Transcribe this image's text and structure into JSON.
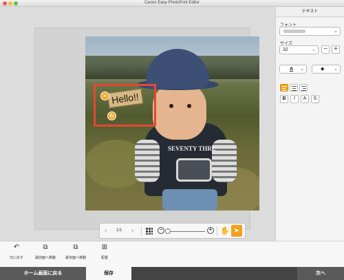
{
  "window": {
    "title": "Canon Easy-PhotoPrint Editor"
  },
  "canvas": {
    "text_frame_text": "Hello!!",
    "close_glyph": "✕",
    "rotate_glyph": "↻",
    "shirt_print": "SEVENTY THRE"
  },
  "zoombar": {
    "prev": "‹",
    "page_indicator": "1/1",
    "next": "›",
    "zoom_out": "−",
    "zoom_in": "+",
    "hand_glyph": "✋",
    "pointer_glyph": "➤",
    "zoom_level": 0.0
  },
  "panel": {
    "title": "テキスト",
    "font_label": "フォント",
    "font_chevron": "⌄",
    "size_label": "サイズ",
    "size_value": "32",
    "size_minus": "−",
    "size_plus": "+",
    "color_glyph": "A",
    "color_value": "#222222",
    "fill_glyph": "◆",
    "bold": "B",
    "italic": "I",
    "outline": "A",
    "shadow": "S"
  },
  "tools": [
    {
      "label": "元に戻す",
      "icon": "undo-icon",
      "glyph": "↶"
    },
    {
      "label": "最前面へ移動",
      "icon": "bring-to-front-icon",
      "glyph": "⧉"
    },
    {
      "label": "最背面へ移動",
      "icon": "send-to-back-icon",
      "glyph": "⧉"
    },
    {
      "label": "配置",
      "icon": "arrange-icon",
      "glyph": "⊞"
    }
  ],
  "footer": {
    "home_label": "ホーム画面に戻る",
    "save_label": "保存",
    "next_label": "次へ"
  },
  "colors": {
    "accent": "#f5a623",
    "frame": "#e64733",
    "footer": "#5a5a5a"
  }
}
